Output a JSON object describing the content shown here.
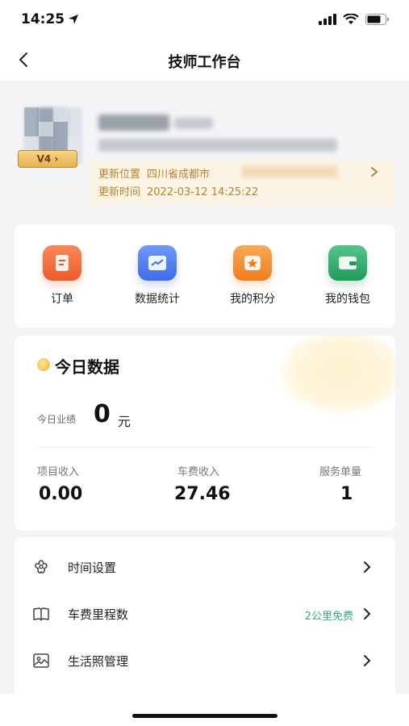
{
  "status_bar": {
    "time": "14:25"
  },
  "nav": {
    "title": "技师工作台"
  },
  "profile": {
    "level": "V4 ›",
    "update_location_label": "更新位置",
    "update_location_value": "四川省成都市",
    "update_time_label": "更新时间",
    "update_time_value": "2022-03-12 14:25:22"
  },
  "quick_menu": [
    {
      "label": "订单",
      "icon": "order-icon",
      "color": "#f0693a"
    },
    {
      "label": "数据统计",
      "icon": "chart-icon",
      "color": "#4a7cf0"
    },
    {
      "label": "我的积分",
      "icon": "points-icon",
      "color": "#f28a2c"
    },
    {
      "label": "我的钱包",
      "icon": "wallet-icon",
      "color": "#2fa36c"
    }
  ],
  "today": {
    "title": "今日数据",
    "performance_label": "今日业绩",
    "performance_value": "0",
    "performance_unit": "元",
    "stats": [
      {
        "label": "项目收入",
        "value": "0.00"
      },
      {
        "label": "车费收入",
        "value": "27.46"
      },
      {
        "label": "服务单量",
        "value": "1"
      }
    ]
  },
  "settings": [
    {
      "label": "时间设置",
      "icon": "flower-icon",
      "extra": ""
    },
    {
      "label": "车费里程数",
      "icon": "book-icon",
      "extra": "2公里免费"
    },
    {
      "label": "生活照管理",
      "icon": "image-icon",
      "extra": ""
    }
  ]
}
